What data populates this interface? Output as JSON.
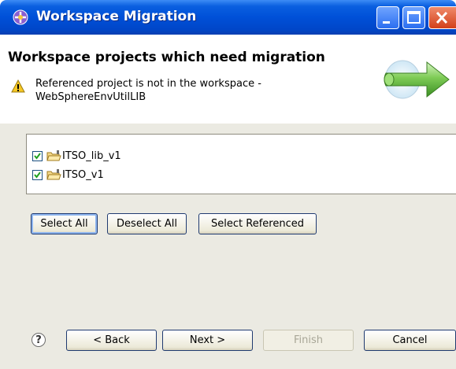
{
  "window": {
    "title": "Workspace Migration",
    "title_icon": "eclipse-migration-icon"
  },
  "header": {
    "title": "Workspace projects which need migration",
    "warning_line1": "Referenced project is not in the workspace -",
    "warning_line2": "WebSphereEnvUtilLIB",
    "warning_icon": "warning-icon",
    "banner_graphic": "green-arrow-icon"
  },
  "projects": [
    {
      "label": "ITSO_lib_v1",
      "checked": true
    },
    {
      "label": "ITSO_v1",
      "checked": true
    }
  ],
  "selection_buttons": {
    "select_all": "Select All",
    "deselect_all": "Deselect All",
    "select_referenced": "Select Referenced"
  },
  "footer": {
    "help": "?",
    "back": "< Back",
    "next": "Next >",
    "finish": "Finish",
    "cancel": "Cancel"
  },
  "colors": {
    "titlebar": "#0050d8",
    "body_bg": "#ebeae2",
    "checkbox_check": "#21a121"
  }
}
